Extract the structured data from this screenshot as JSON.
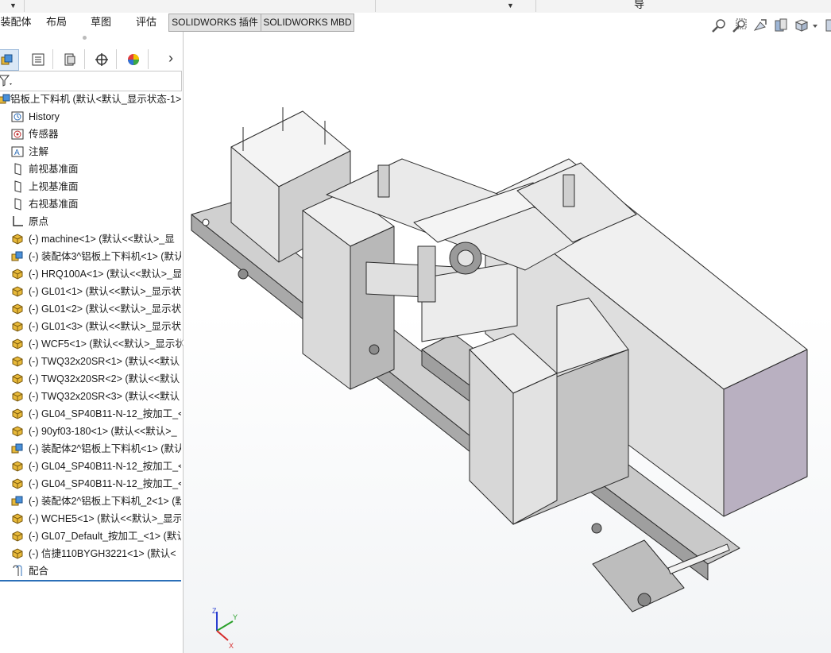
{
  "window": {
    "tab_bar": [
      {
        "label": "装配体",
        "style": "plain"
      },
      {
        "label": "布局",
        "style": "plain"
      },
      {
        "label": "草图",
        "style": "plain"
      },
      {
        "label": "评估",
        "style": "active"
      },
      {
        "label": "SOLIDWORKS 插件",
        "style": "boxed"
      },
      {
        "label": "SOLIDWORKS MBD",
        "style": "boxed"
      }
    ],
    "top_strip_text": "导"
  },
  "feature_manager": {
    "tabs": [
      {
        "icon": "feature-manager-icon",
        "selected": true
      },
      {
        "icon": "property-manager-icon",
        "selected": false
      },
      {
        "icon": "configuration-manager-icon",
        "selected": false
      },
      {
        "icon": "dimxpert-manager-icon",
        "selected": false
      },
      {
        "icon": "display-manager-icon",
        "selected": false
      }
    ],
    "more_label": "›",
    "tree": [
      {
        "icon": "assembly-icon",
        "label": "铝板上下料机  (默认<默认_显示状态-1>",
        "indent": 0
      },
      {
        "icon": "history-icon",
        "label": "History",
        "indent": 1
      },
      {
        "icon": "sensor-icon",
        "label": "传感器",
        "indent": 1
      },
      {
        "icon": "annotation-icon",
        "label": "注解",
        "indent": 1
      },
      {
        "icon": "plane-icon",
        "label": "前视基准面",
        "indent": 1
      },
      {
        "icon": "plane-icon",
        "label": "上视基准面",
        "indent": 1
      },
      {
        "icon": "plane-icon",
        "label": "右视基准面",
        "indent": 1
      },
      {
        "icon": "origin-icon",
        "label": "原点",
        "indent": 1
      },
      {
        "icon": "part-icon",
        "label": "(-) machine<1> (默认<<默认>_显",
        "indent": 1
      },
      {
        "icon": "subassembly-icon",
        "label": "(-) 装配体3^铝板上下料机<1> (默认",
        "indent": 1
      },
      {
        "icon": "part-icon",
        "label": "(-) HRQ100A<1> (默认<<默认>_显",
        "indent": 1
      },
      {
        "icon": "part-icon",
        "label": "(-) GL01<1> (默认<<默认>_显示状",
        "indent": 1
      },
      {
        "icon": "part-icon",
        "label": "(-) GL01<2> (默认<<默认>_显示状",
        "indent": 1
      },
      {
        "icon": "part-icon",
        "label": "(-) GL01<3> (默认<<默认>_显示状",
        "indent": 1
      },
      {
        "icon": "part-icon",
        "label": "(-) WCF5<1> (默认<<默认>_显示状",
        "indent": 1
      },
      {
        "icon": "part-icon",
        "label": "(-) TWQ32x20SR<1> (默认<<默认",
        "indent": 1
      },
      {
        "icon": "part-icon",
        "label": "(-) TWQ32x20SR<2> (默认<<默认",
        "indent": 1
      },
      {
        "icon": "part-icon",
        "label": "(-) TWQ32x20SR<3> (默认<<默认",
        "indent": 1
      },
      {
        "icon": "part-icon",
        "label": "(-) GL04_SP40B11-N-12_按加工_<",
        "indent": 1
      },
      {
        "icon": "part-icon",
        "label": "(-) 90yf03-180<1> (默认<<默认>_",
        "indent": 1
      },
      {
        "icon": "subassembly-icon",
        "label": "(-) 装配体2^铝板上下料机<1> (默认",
        "indent": 1
      },
      {
        "icon": "part-icon",
        "label": "(-) GL04_SP40B11-N-12_按加工_<",
        "indent": 1
      },
      {
        "icon": "part-icon",
        "label": "(-) GL04_SP40B11-N-12_按加工_<",
        "indent": 1
      },
      {
        "icon": "subassembly-icon",
        "label": "(-) 装配体2^铝板上下料机_2<1> (默",
        "indent": 1
      },
      {
        "icon": "part-icon",
        "label": "(-) WCHE5<1> (默认<<默认>_显示",
        "indent": 1
      },
      {
        "icon": "part-icon",
        "label": "(-) GL07_Default_按加工_<1> (默认",
        "indent": 1
      },
      {
        "icon": "part-icon",
        "label": "(-) 信捷110BYGH3221<1> (默认<",
        "indent": 1
      },
      {
        "icon": "mates-icon",
        "label": "配合",
        "indent": 1
      }
    ]
  },
  "heads_up_toolbar": [
    "zoom-to-fit-icon",
    "zoom-to-area-icon",
    "previous-view-icon",
    "section-view-icon",
    "view-orientation-icon",
    "dropdown-arrow-icon",
    "display-style-icon"
  ],
  "triad": {
    "x_label": "X",
    "y_label": "Y",
    "z_label": "Z"
  },
  "colors": {
    "tab_boxed_bg": "#e1e1e1",
    "selected_tab_bg": "#dbe8f6",
    "part_icon": "#e8b93a",
    "assembly_icon": "#4a90d9",
    "model_face": "#e6e6e6",
    "model_side": "#bdbdbd",
    "model_edge": "#2a2a2a",
    "machine_side_purple": "#b9b0c1"
  }
}
